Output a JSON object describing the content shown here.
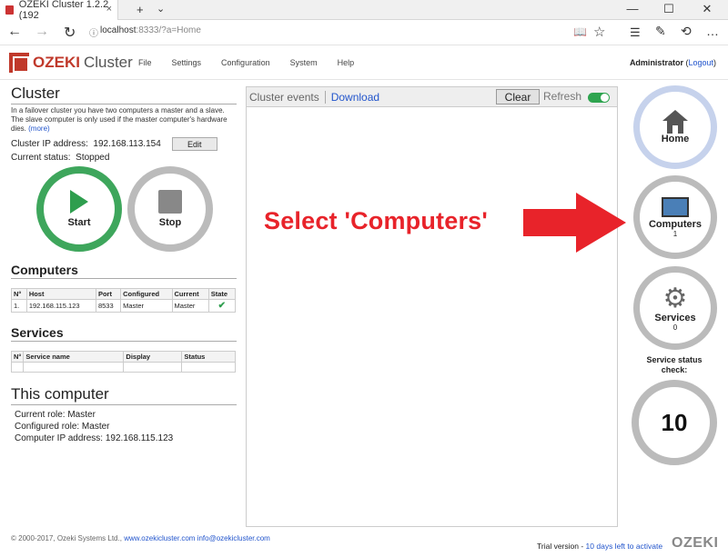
{
  "browser": {
    "tab_title": "OZEKI Cluster 1.2.2 (192",
    "tab_close": "×",
    "new_tab": "+",
    "tab_dropdown": "⌄",
    "win_min": "—",
    "win_max": "☐",
    "win_close": "✕",
    "url_host": "localhost",
    "url_rest": ":8333/?a=Home",
    "back": "←",
    "forward": "→",
    "reload": "↻",
    "lock": "ⓘ",
    "reading": "📖",
    "favorite": "☆",
    "hub": "☰",
    "note": "✎",
    "share": "⟲",
    "more": "…"
  },
  "header": {
    "logo_main": "OZEKI",
    "logo_sub": "Cluster",
    "menu": [
      "File",
      "Settings",
      "Configuration",
      "System",
      "Help"
    ],
    "admin_name": "Administrator",
    "logout_prefix": "(",
    "logout_label": "Logout",
    "logout_suffix": ")"
  },
  "cluster": {
    "title": "Cluster",
    "description": "In a failover cluster you have two computers a master and a slave. The slave computer is only used if the master computer's hardware dies.",
    "more": "(more)",
    "ip_label": "Cluster IP address:",
    "ip_value": "192.168.113.154",
    "edit": "Edit",
    "status_label": "Current status:",
    "status_value": "Stopped",
    "start": "Start",
    "stop": "Stop"
  },
  "computers": {
    "title": "Computers",
    "headers": [
      "N°",
      "Host",
      "Port",
      "Configured",
      "Current",
      "State"
    ],
    "rows": [
      {
        "n": "1.",
        "host": "192.168.115.123",
        "port": "8533",
        "configured": "Master",
        "current": "Master",
        "state": "✔"
      }
    ]
  },
  "services": {
    "title": "Services",
    "headers": [
      "N°",
      "Service name",
      "Display",
      "Status"
    ]
  },
  "this_computer": {
    "title": "This computer",
    "current_role": "Current role: Master",
    "configured_role": "Configured role: Master",
    "ip": "Computer IP address: 192.168.115.123"
  },
  "events": {
    "title": "Cluster events",
    "download": "Download",
    "clear": "Clear",
    "refresh": "Refresh",
    "refresh_on": true
  },
  "annotation": {
    "text": "Select 'Computers'",
    "color": "#e8232a"
  },
  "nav": {
    "home": "Home",
    "computers": "Computers",
    "computers_count": "1",
    "services": "Services",
    "services_count": "0",
    "status_check": "Service status check:",
    "countdown": "10"
  },
  "footer": {
    "copyright": "© 2000-2017, Ozeki Systems Ltd.,",
    "site": "www.ozekicluster.com",
    "email": "info@ozekicluster.com",
    "trial_prefix": "Trial version -",
    "trial_link": "10 days left to activate",
    "brand": "OZEKI"
  },
  "colors": {
    "brand_red": "#c0392b",
    "start_green": "#2e9e4e",
    "link_blue": "#2255cc",
    "toggle_green": "#2ea44f"
  }
}
